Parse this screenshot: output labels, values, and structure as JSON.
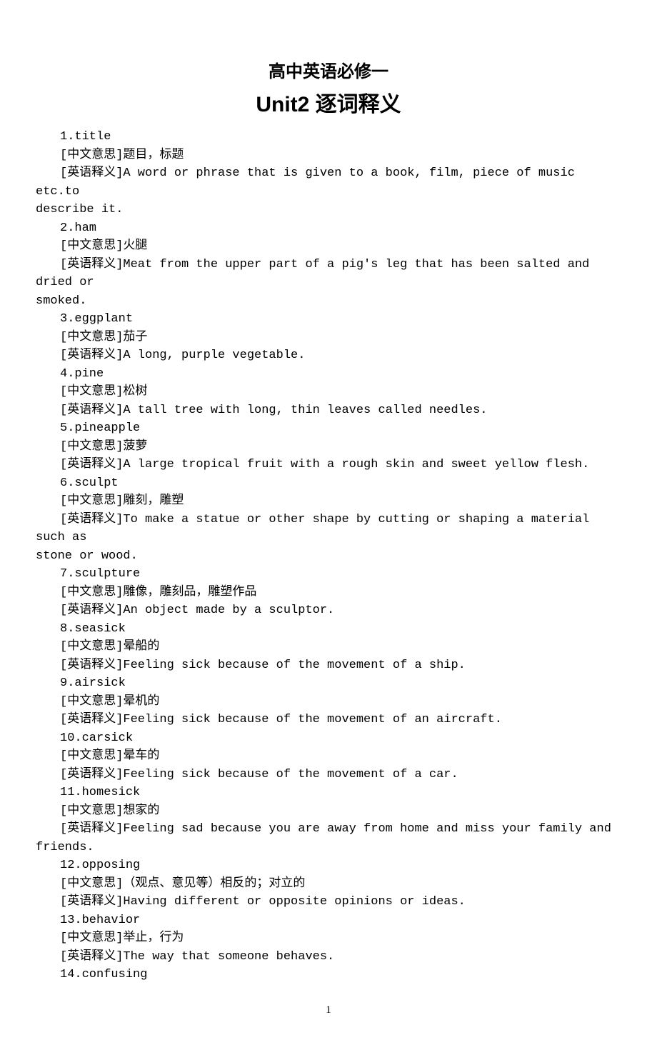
{
  "titles": {
    "main": "高中英语必修一",
    "sub": "Unit2 逐词释义"
  },
  "labels": {
    "cn": "[中文意思]",
    "en": "[英语释义]"
  },
  "entries": [
    {
      "num": "1.",
      "word": "title",
      "cn": "题目，标题",
      "en_lines": [
        "A word or phrase that is given to a book, film, piece of music etc.to",
        "describe it."
      ]
    },
    {
      "num": "2.",
      "word": "ham",
      "cn": "火腿",
      "en_lines": [
        "Meat from the upper part of a pig's leg that has been salted and dried or",
        "smoked."
      ]
    },
    {
      "num": "3.",
      "word": "eggplant",
      "cn": "茄子",
      "en_lines": [
        "A long, purple vegetable."
      ]
    },
    {
      "num": "4.",
      "word": "pine",
      "cn": "松树",
      "en_lines": [
        "A tall tree with long, thin leaves called needles."
      ]
    },
    {
      "num": "5.",
      "word": "pineapple",
      "cn": "菠萝",
      "en_lines": [
        "A large tropical fruit with a rough skin and sweet yellow flesh."
      ]
    },
    {
      "num": "6.",
      "word": "sculpt",
      "cn": "雕刻，雕塑",
      "en_lines": [
        "To make a statue or other shape by cutting or shaping a material such as",
        "stone or wood."
      ]
    },
    {
      "num": "7.",
      "word": "sculpture",
      "cn": "雕像，雕刻品，雕塑作品",
      "en_lines": [
        "An object made by a sculptor."
      ]
    },
    {
      "num": "8.",
      "word": "seasick",
      "cn": "晕船的",
      "en_lines": [
        "Feeling sick because of the movement of a ship."
      ]
    },
    {
      "num": "9.",
      "word": "airsick",
      "cn": "晕机的",
      "en_lines": [
        "Feeling sick because of the movement of an aircraft."
      ]
    },
    {
      "num": "10.",
      "word": "carsick",
      "cn": "晕车的",
      "en_lines": [
        "Feeling sick because of the movement of a car."
      ]
    },
    {
      "num": "11.",
      "word": "homesick",
      "cn": "想家的",
      "en_lines": [
        "Feeling sad because you are away from home and miss your family and",
        "friends."
      ]
    },
    {
      "num": "12.",
      "word": "opposing",
      "cn": "（观点、意见等）相反的；对立的",
      "en_lines": [
        "Having different or opposite opinions or ideas."
      ]
    },
    {
      "num": "13.",
      "word": "behavior",
      "cn": "举止，行为",
      "en_lines": [
        "The way that someone behaves."
      ]
    },
    {
      "num": "14.",
      "word": "confusing",
      "cn": "",
      "en_lines": []
    }
  ],
  "page_number": "1"
}
